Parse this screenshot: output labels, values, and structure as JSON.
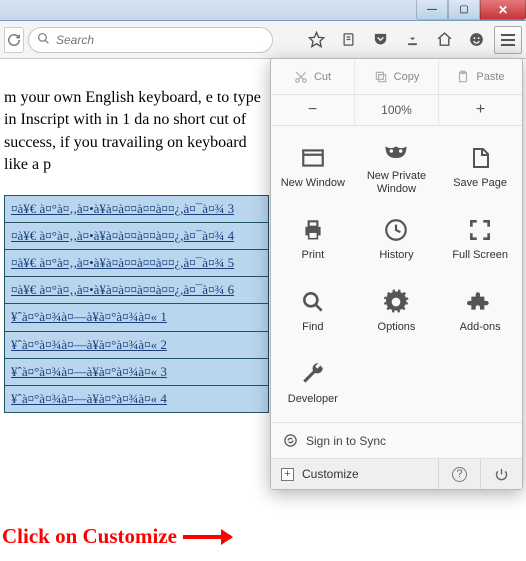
{
  "window": {
    "min": "—",
    "max": "▢",
    "close": "✕"
  },
  "toolbar": {
    "search_placeholder": "Search"
  },
  "page": {
    "para": "m your own English keyboard, e to type in Inscript with in 1 da no short cut of success, if you  travailing on keyboard like a p",
    "links": [
      "¤à¥€ à¤°à¤‚,à¤•à¥à¤à¤¤à¤¤à¤¤¿,à¤¯à¤¾ 3",
      "¤à¥€ à¤°à¤‚,à¤•à¥à¤à¤¤à¤¤à¤¤¿,à¤¯à¤¾ 4",
      "¤à¥€ à¤°à¤‚,à¤•à¥à¤à¤¤à¤¤à¤¤¿,à¤¯à¤¾ 5",
      "¤à¥€ à¤°à¤‚,à¤•à¥à¤à¤¤à¤¤à¤¤¿,à¤¯à¤¾ 6",
      "¥ˆà¤°à¤¾à¤—à¥à¤°à¤¾à¤« 1",
      "¥ˆà¤°à¤¾à¤—à¥à¤°à¤¾à¤« 2",
      "¥ˆà¤°à¤¾à¤—à¥à¤°à¤¾à¤« 3",
      "¥ˆà¤°à¤¾à¤—à¥à¤°à¤¾à¤« 4"
    ],
    "callout": "Click on Customize"
  },
  "menu": {
    "cut": "Cut",
    "copy": "Copy",
    "paste": "Paste",
    "zoom_minus": "−",
    "zoom_level": "100%",
    "zoom_plus": "+",
    "items": [
      {
        "label": "New Window"
      },
      {
        "label": "New Private\nWindow"
      },
      {
        "label": "Save Page"
      },
      {
        "label": "Print"
      },
      {
        "label": "History"
      },
      {
        "label": "Full Screen"
      },
      {
        "label": "Find"
      },
      {
        "label": "Options"
      },
      {
        "label": "Add-ons"
      },
      {
        "label": "Developer"
      }
    ],
    "signin": "Sign in to Sync",
    "customize": "Customize",
    "help": "?",
    "power": "⏻"
  }
}
